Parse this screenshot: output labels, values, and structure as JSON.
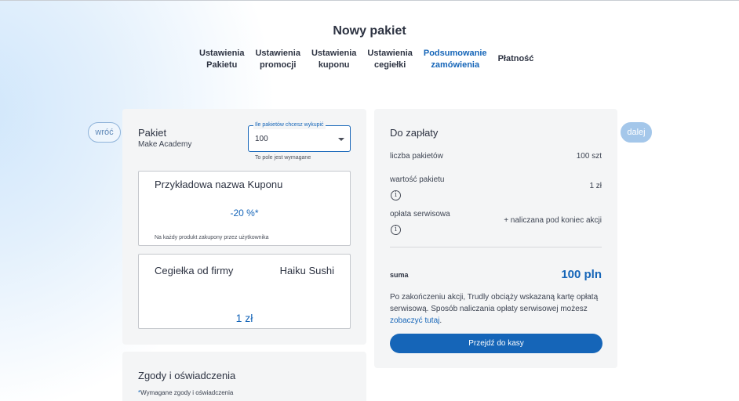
{
  "page": {
    "title": "Nowy pakiet"
  },
  "steps": [
    {
      "line1": "Ustawienia",
      "line2": "Pakietu",
      "active": false
    },
    {
      "line1": "Ustawienia",
      "line2": "promocji",
      "active": false
    },
    {
      "line1": "Ustawienia",
      "line2": "kuponu",
      "active": false
    },
    {
      "line1": "Ustawienia",
      "line2": "cegiełki",
      "active": false
    },
    {
      "line1": "Podsumowanie",
      "line2": "zamówienia",
      "active": true
    },
    {
      "line1": "Płatność",
      "line2": "",
      "active": false
    }
  ],
  "nav": {
    "back_label": "wróć",
    "next_label": "dalej"
  },
  "package": {
    "title": "Pakiet",
    "subtitle": "Make Academy",
    "select": {
      "label": "Ile pakietów chcesz wykupić",
      "value": "100",
      "helper": "To pole jest wymagane"
    }
  },
  "coupon": {
    "name": "Przykładowa nazwa Kuponu",
    "value": "-20 %*",
    "note": "Na każdy produkt zakupony przez użytkownika"
  },
  "brick": {
    "name": "Cegiełka od firmy",
    "company": "Haiku Sushi",
    "amount": "1 zł"
  },
  "payment": {
    "title": "Do zapłaty",
    "rows": [
      {
        "label": "liczba pakietów",
        "value": "100 szt"
      },
      {
        "label": "wartość pakietu",
        "value": "1 zł"
      },
      {
        "label": "opłata serwisowa",
        "value": "+ naliczana pod koniec akcji"
      }
    ],
    "sum_label": "suma",
    "sum_value": "100 pln",
    "note_text": "Po zakończeniu akcji, Trudly obciąży wskazaną kartę opłatą serwisową. Sposób naliczania opłaty serwisowej możesz ",
    "note_link": "zobaczyć tutaj",
    "note_end": ".",
    "checkout_label": "Przejdź do kasy"
  },
  "consents": {
    "title": "Zgody i oświadczenia",
    "star": "*",
    "note": "Wymagane zgody i oświadczenia"
  },
  "icons": {
    "info": "info-icon",
    "caret": "chevron-down-icon"
  },
  "colors": {
    "accent": "#1565b8",
    "next_button": "#a4c7ea",
    "card": "#f4f5f6"
  }
}
